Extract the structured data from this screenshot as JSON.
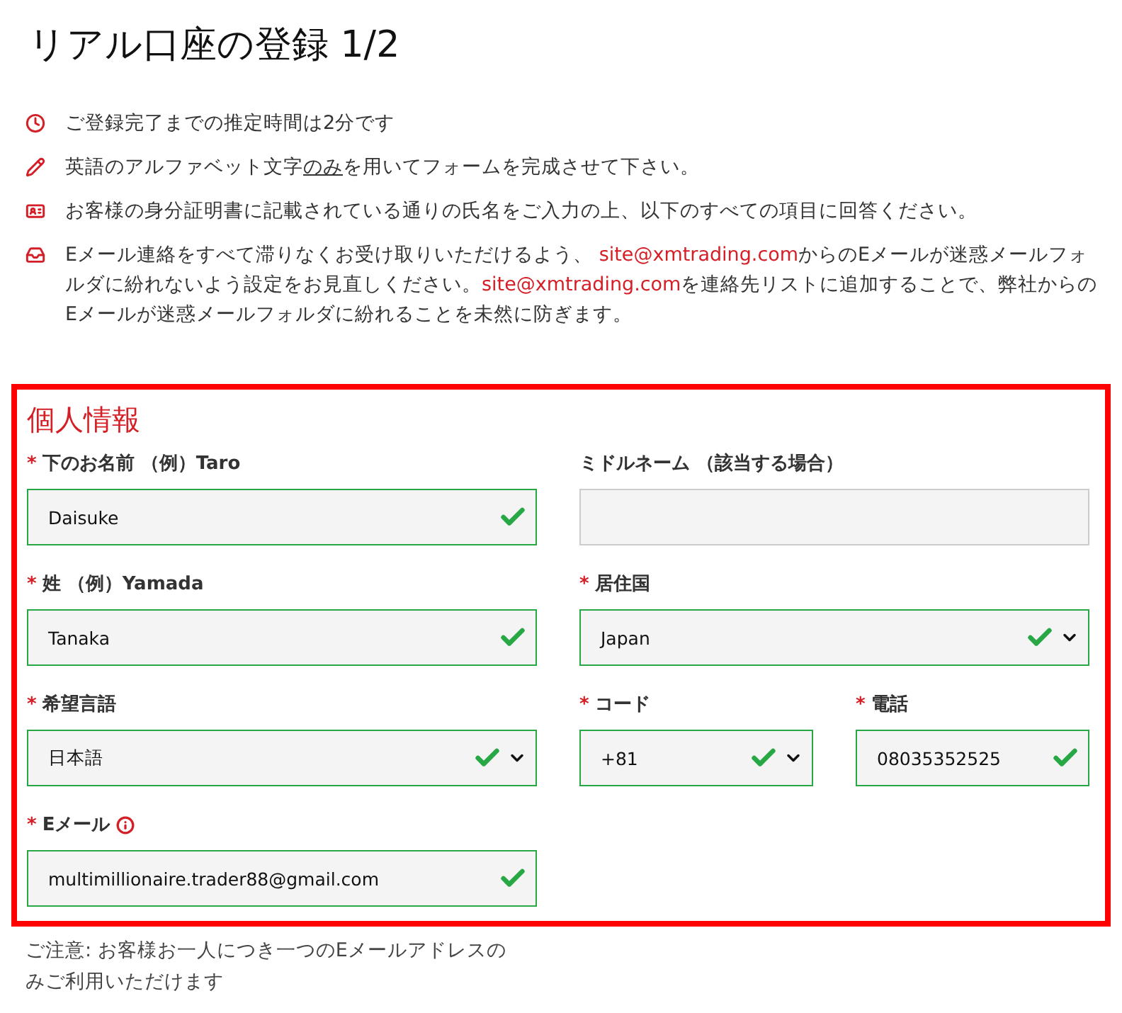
{
  "title": "リアル口座の登録 1/2",
  "notes": [
    {
      "segments": [
        {
          "kind": "text",
          "text": "ご登録完了までの推定時間は2分です"
        }
      ]
    },
    {
      "segments": [
        {
          "kind": "text",
          "text": "英語のアルファベット文字"
        },
        {
          "kind": "underline",
          "text": "のみ"
        },
        {
          "kind": "text",
          "text": "を用いてフォームを完成させて下さい。"
        }
      ]
    },
    {
      "segments": [
        {
          "kind": "text",
          "text": "お客様の身分証明書に記載されている通りの氏名をご入力の上、以下のすべての項目に回答ください。"
        }
      ]
    },
    {
      "segments": [
        {
          "kind": "text",
          "text": "Eメール連絡をすべて滞りなくお受け取りいただけるよう、 "
        },
        {
          "kind": "link",
          "text": "site@xmtrading.com"
        },
        {
          "kind": "text",
          "text": "からのEメールが迷惑メールフォルダに紛れないよう設定をお見直しください。"
        },
        {
          "kind": "link",
          "text": "site@xmtrading.com"
        },
        {
          "kind": "text",
          "text": "を連絡先リストに追加することで、弊社からのEメールが迷惑メールフォルダに紛れることを未然に防ぎます。"
        }
      ]
    }
  ],
  "section": {
    "title": "個人情報",
    "rows": [
      [
        {
          "label": "下のお名前 （例）Taro",
          "marker": "*",
          "kind": "text",
          "value": "Daisuke",
          "valid": true
        },
        {
          "label": "ミドルネーム （該当する場合）",
          "kind": "text",
          "valid": false
        }
      ],
      [
        {
          "label": "姓 （例）Yamada",
          "marker": "*",
          "kind": "text",
          "value": "Tanaka",
          "valid": true
        },
        {
          "label": "居住国",
          "marker": "*",
          "kind": "select",
          "value": "Japan",
          "valid": true
        }
      ],
      [
        {
          "label": "希望言語",
          "marker": "*",
          "kind": "select",
          "value": "日本語",
          "valid": true
        },
        {
          "label": "コード",
          "marker": "*",
          "kind": "select",
          "value": "+81",
          "valid": true
        },
        {
          "label": "電話",
          "marker": "*",
          "kind": "text",
          "value": "08035352525",
          "valid": true
        }
      ],
      [
        {
          "label": "Eメール",
          "marker": "*",
          "info": true,
          "kind": "text",
          "value": "multimillionaire.trader88@gmail.com",
          "valid": true
        }
      ]
    ]
  },
  "footnote": "ご注意: お客様お一人につき一つのEメールアドレスのみご利用いただけます"
}
